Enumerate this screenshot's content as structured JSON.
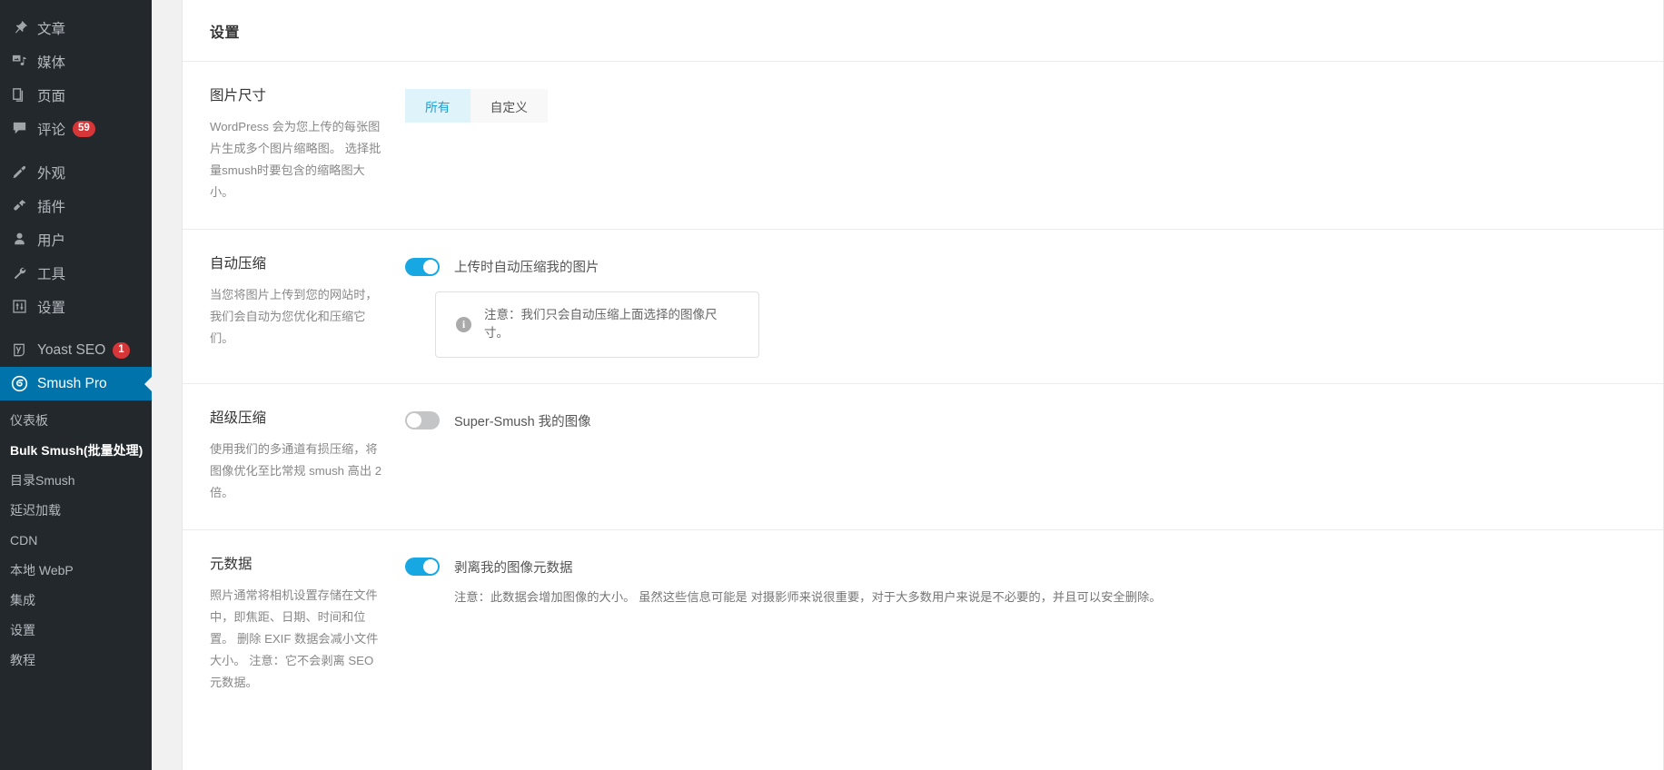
{
  "sidebar": {
    "items": [
      {
        "label": "文章",
        "icon": "pin-icon",
        "badge": null
      },
      {
        "label": "媒体",
        "icon": "media-icon",
        "badge": null
      },
      {
        "label": "页面",
        "icon": "pages-icon",
        "badge": null
      },
      {
        "label": "评论",
        "icon": "comment-icon",
        "badge": "59"
      },
      {
        "label": "外观",
        "icon": "appearance-brush-icon",
        "badge": null
      },
      {
        "label": "插件",
        "icon": "plugin-icon",
        "badge": null
      },
      {
        "label": "用户",
        "icon": "user-icon",
        "badge": null
      },
      {
        "label": "工具",
        "icon": "wrench-icon",
        "badge": null
      },
      {
        "label": "设置",
        "icon": "settings-sliders-icon",
        "badge": null
      },
      {
        "label": "Yoast SEO",
        "icon": "yoast-icon",
        "badge": "1"
      },
      {
        "label": "Smush Pro",
        "icon": "smush-icon",
        "badge": null
      }
    ],
    "submenu": [
      {
        "label": "仪表板",
        "current": false
      },
      {
        "label": "Bulk Smush(批量处理)",
        "current": true
      },
      {
        "label": "目录Smush",
        "current": false
      },
      {
        "label": "延迟加载",
        "current": false
      },
      {
        "label": "CDN",
        "current": false
      },
      {
        "label": "本地 WebP",
        "current": false
      },
      {
        "label": "集成",
        "current": false
      },
      {
        "label": "设置",
        "current": false
      },
      {
        "label": "教程",
        "current": false
      }
    ],
    "colors": {
      "bg": "#23282d",
      "active": "#0073aa",
      "badge": "#d63638"
    }
  },
  "page": {
    "title": "设置",
    "accent": "#17a8e3"
  },
  "sections": [
    {
      "title": "图片尺寸",
      "description": "WordPress 会为您上传的每张图片生成多个图片缩略图。 选择批量smush时要包含的缩略图大小。",
      "control": "segmented",
      "options": [
        {
          "label": "所有",
          "selected": true
        },
        {
          "label": "自定义",
          "selected": false
        }
      ]
    },
    {
      "title": "自动压缩",
      "description": "当您将图片上传到您的网站时，我们会自动为您优化和压缩它们。",
      "control": "toggle",
      "toggle": {
        "on": true,
        "label": "上传时自动压缩我的图片"
      },
      "notice": {
        "icon": "info-icon",
        "text": "注意：我们只会自动压缩上面选择的图像尺寸。"
      }
    },
    {
      "title": "超级压缩",
      "description": "使用我们的多通道有损压缩，将图像优化至比常规 smush 高出 2 倍。",
      "control": "toggle",
      "toggle": {
        "on": false,
        "label": "Super-Smush 我的图像"
      }
    },
    {
      "title": "元数据",
      "description": "照片通常将相机设置存储在文件中，即焦距、日期、时间和位置。 删除 EXIF 数据会减小文件大小。 注意：它不会剥离 SEO 元数据。",
      "control": "toggle",
      "toggle": {
        "on": true,
        "label": "剥离我的图像元数据"
      },
      "sub_description": "注意：此数据会增加图像的大小。 虽然这些信息可能是 对摄影师来说很重要，对于大多数用户来说是不必要的，并且可以安全删除。"
    }
  ]
}
